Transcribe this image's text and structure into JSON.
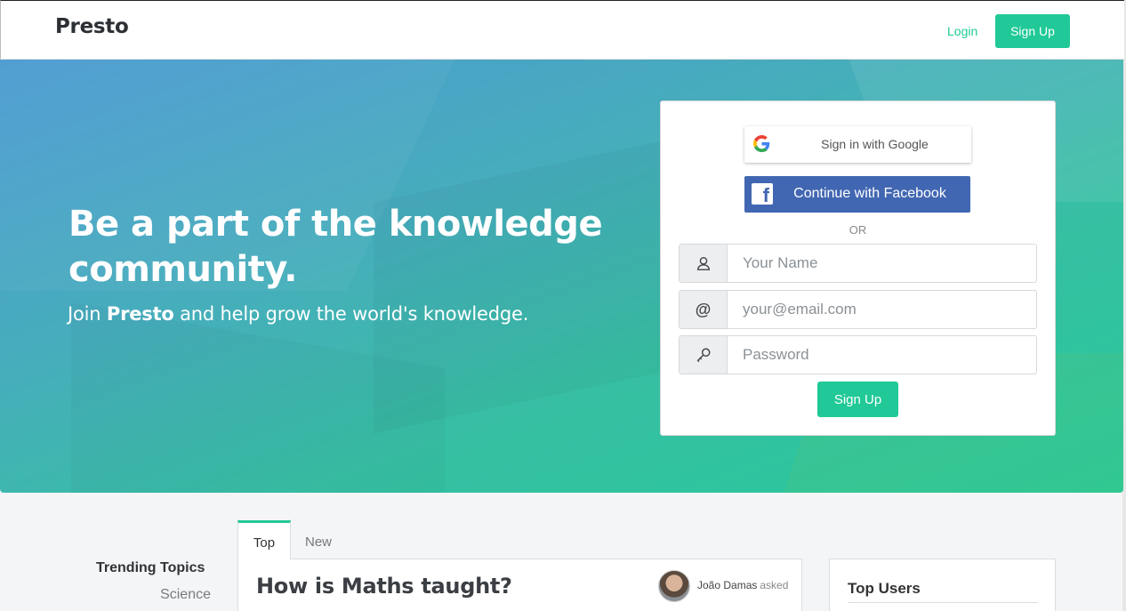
{
  "header": {
    "brand": "Presto",
    "login_label": "Login",
    "signup_label": "Sign Up"
  },
  "hero": {
    "title": "Be a part of the knowledge community.",
    "subtitle_prefix": "Join ",
    "subtitle_brand": "Presto",
    "subtitle_suffix": " and help grow the world's knowledge."
  },
  "signup_card": {
    "google_label": "Sign in with Google",
    "facebook_label": "Continue with Facebook",
    "or_label": "OR",
    "name_placeholder": "Your Name",
    "email_placeholder": "your@email.com",
    "password_placeholder": "Password",
    "submit_label": "Sign Up"
  },
  "trending": {
    "title": "Trending Topics",
    "items": [
      "Science"
    ]
  },
  "feed": {
    "tabs": [
      {
        "label": "Top",
        "active": true
      },
      {
        "label": "New",
        "active": false
      }
    ],
    "questions": [
      {
        "title": "How is Maths taught?",
        "author": "João Damas",
        "action": "asked"
      }
    ]
  },
  "top_users": {
    "title": "Top Users"
  },
  "colors": {
    "accent": "#20c997",
    "facebook": "#4267b2",
    "hero_gradient_start": "#4b9bd2",
    "hero_gradient_end": "#27c99a"
  },
  "icons": {
    "google": "google-g-logo",
    "facebook": "facebook-f-logo",
    "name": "user-icon",
    "email": "at-icon",
    "password": "key-icon"
  }
}
